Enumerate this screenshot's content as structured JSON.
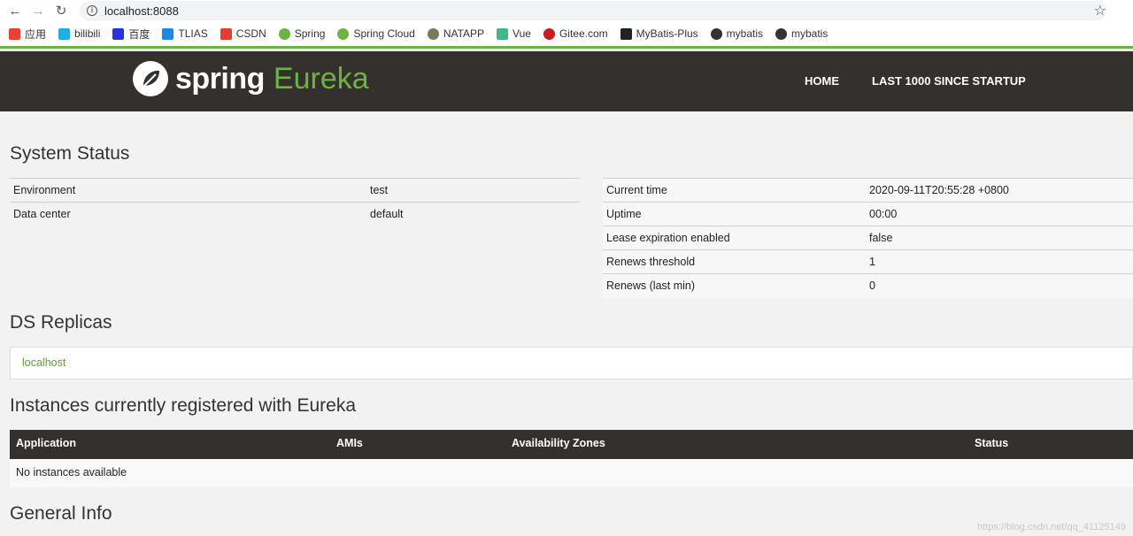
{
  "browser": {
    "url": "localhost:8088",
    "bookmarks": [
      {
        "label": "应用",
        "color": "#e94235"
      },
      {
        "label": "bilibili",
        "color": "#23ade5"
      },
      {
        "label": "百度",
        "color": "#2932e1"
      },
      {
        "label": "TLIAS",
        "color": "#1e88e5"
      },
      {
        "label": "CSDN",
        "color": "#e33e33"
      },
      {
        "label": "Spring",
        "color": "#6db33f"
      },
      {
        "label": "Spring Cloud",
        "color": "#6db33f"
      },
      {
        "label": "NATAPP",
        "color": "#7a7a5a"
      },
      {
        "label": "Vue",
        "color": "#41b883"
      },
      {
        "label": "Gitee.com",
        "color": "#c71d23"
      },
      {
        "label": "MyBatis-Plus",
        "color": "#222222"
      },
      {
        "label": "mybatis",
        "color": "#333333"
      },
      {
        "label": "mybatis",
        "color": "#333333"
      }
    ]
  },
  "header": {
    "logo_spring": "spring",
    "logo_eureka": "Eureka",
    "nav_home": "HOME",
    "nav_last": "LAST 1000 SINCE STARTUP"
  },
  "system_status": {
    "title": "System Status",
    "left": [
      {
        "key": "Environment",
        "value": "test"
      },
      {
        "key": "Data center",
        "value": "default"
      }
    ],
    "right": [
      {
        "key": "Current time",
        "value": "2020-09-11T20:55:28 +0800"
      },
      {
        "key": "Uptime",
        "value": "00:00"
      },
      {
        "key": "Lease expiration enabled",
        "value": "false"
      },
      {
        "key": "Renews threshold",
        "value": "1"
      },
      {
        "key": "Renews (last min)",
        "value": "0"
      }
    ]
  },
  "ds_replicas": {
    "title": "DS Replicas",
    "items": [
      "localhost"
    ]
  },
  "instances": {
    "title": "Instances currently registered with Eureka",
    "columns": [
      "Application",
      "AMIs",
      "Availability Zones",
      "Status"
    ],
    "empty_text": "No instances available"
  },
  "general_info": {
    "title": "General Info"
  },
  "watermark": "https://blog.csdn.net/qq_41125149",
  "colors": {
    "brand_green": "#6db33f",
    "header_bg": "#34302d"
  }
}
